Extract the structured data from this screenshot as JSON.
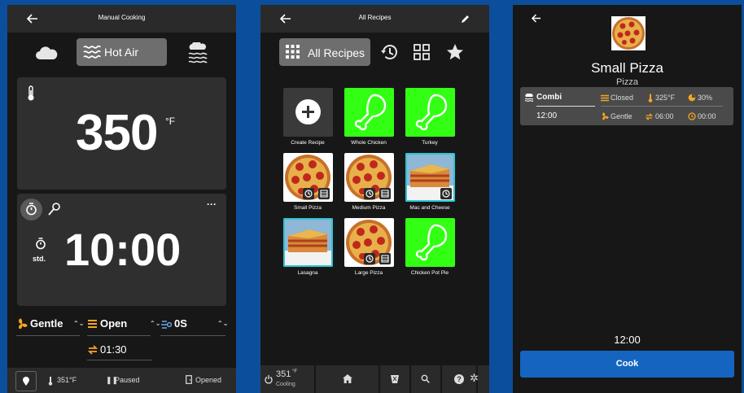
{
  "panels": {
    "manual": {
      "title": "Manual Cooking",
      "modes": {
        "left_icon": "cloud-icon",
        "selected": "Hot Air",
        "selected_icon": "hot-air-icon",
        "right_icon": "steam-icon"
      },
      "temperature": {
        "value": "350",
        "unit": "°F"
      },
      "timer": {
        "value": "10:00",
        "mode_label": "std."
      },
      "settings": {
        "fan": "Gentle",
        "vent": "Open",
        "humidity": "0S",
        "delay": "01:30"
      },
      "status_bar": {
        "current_temp": "351°F",
        "state": "Paused",
        "door": "Opened"
      }
    },
    "recipes": {
      "title": "All Recipes",
      "filter_selected": "All Recipes",
      "tiles": [
        {
          "label": "Create Recipe",
          "kind": "create"
        },
        {
          "label": "Whole Chicken",
          "kind": "drumstick"
        },
        {
          "label": "Turkey",
          "kind": "drumstick"
        },
        {
          "label": "Small Pizza",
          "kind": "pizza"
        },
        {
          "label": "Medium Pizza",
          "kind": "pizza"
        },
        {
          "label": "Mac and Cheese",
          "kind": "lasagna"
        },
        {
          "label": "Lasagna",
          "kind": "lasagna"
        },
        {
          "label": "Large Pizza",
          "kind": "pizza"
        },
        {
          "label": "Chicken Pot Pie",
          "kind": "drumstick"
        }
      ],
      "status": {
        "temp": "351",
        "unit_label": "°F",
        "state": "Cooling"
      }
    },
    "detail": {
      "name": "Small Pizza",
      "category": "Pizza",
      "step": {
        "mode": "Combi",
        "vent": "Closed",
        "temp": "325°F",
        "humidity": "30%",
        "time": "12:00",
        "fan": "Gentle",
        "delay": "06:00",
        "hold": "00:00"
      },
      "total_time": "12:00",
      "cook_label": "Cook"
    }
  },
  "colors": {
    "accent": "#f5a623",
    "cook_button": "#1565c0",
    "tile_green": "#32ff14",
    "tile_border": "#2ec4d6"
  }
}
